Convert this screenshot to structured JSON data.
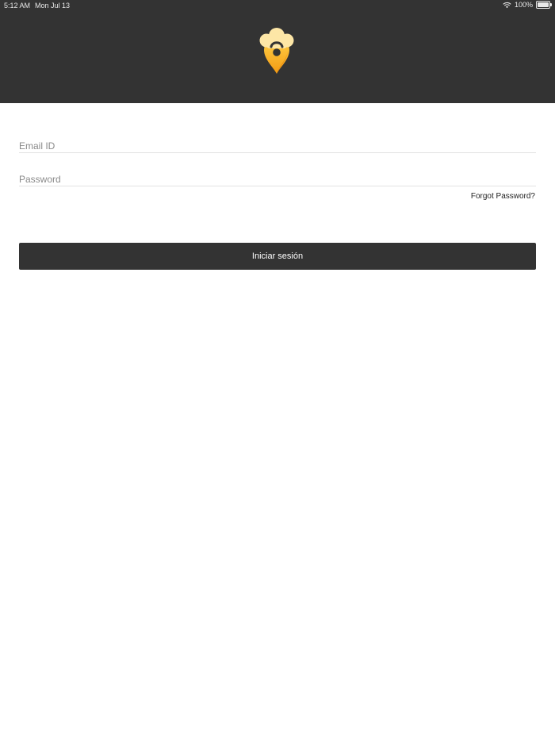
{
  "status_bar": {
    "time": "5:12 AM",
    "date": "Mon Jul 13",
    "battery": "100%",
    "icons": [
      "wifi-icon",
      "battery-icon"
    ]
  },
  "brand": {
    "logo": "chef-hat-location-pin-logo",
    "colors": {
      "header": "#333333",
      "logo_orange": "#f39a12",
      "logo_yellow": "#ffd24a",
      "logo_cream": "#fde6a6"
    }
  },
  "form": {
    "email_placeholder": "Email ID",
    "password_placeholder": "Password",
    "forgot_label": "Forgot Password?",
    "submit_label": "Iniciar sesión"
  }
}
